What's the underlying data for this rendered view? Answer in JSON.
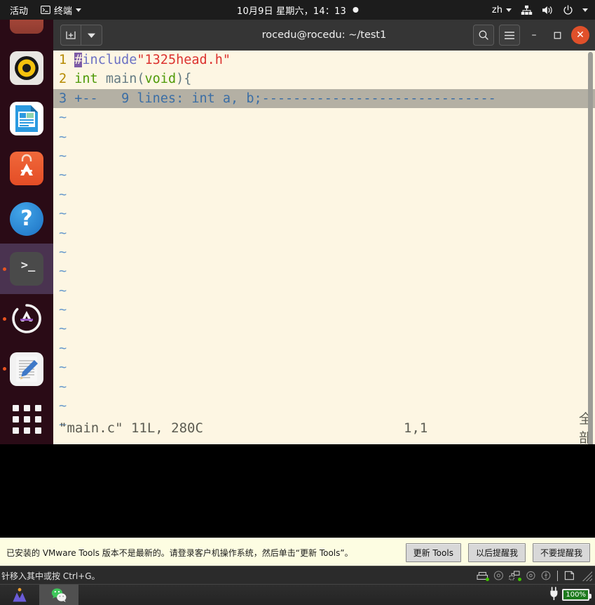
{
  "topbar": {
    "activities": "活动",
    "app_icon": "terminal-appmenu-icon",
    "app_name": "终端",
    "datetime": "10月9日 星期六，14：13",
    "notification_dot": "notification-indicator",
    "keyboard_layout": "zh",
    "system_icons": [
      "network-icon",
      "volume-icon",
      "power-icon",
      "system-menu-caret"
    ]
  },
  "dock": {
    "items": [
      {
        "name": "firefox",
        "label": "Firefox",
        "running": false,
        "active": false
      },
      {
        "name": "rhythmbox",
        "label": "Rhythmbox",
        "running": false,
        "active": false
      },
      {
        "name": "libreoffice-impress",
        "label": "LibreOffice Impress",
        "running": false,
        "active": false
      },
      {
        "name": "ubuntu-software",
        "label": "Ubuntu Software",
        "running": false,
        "active": false
      },
      {
        "name": "help",
        "label": "Help",
        "running": false,
        "active": false
      },
      {
        "name": "terminal",
        "label": "终端",
        "running": true,
        "active": true,
        "glyph": ">_"
      },
      {
        "name": "software-updater",
        "label": "Software Updater",
        "running": true,
        "active": false
      },
      {
        "name": "text-editor",
        "label": "Text Editor",
        "running": true,
        "active": false
      },
      {
        "name": "show-applications",
        "label": "显示应用程序",
        "running": false,
        "active": false
      }
    ]
  },
  "terminal": {
    "title": "rocedu@rocedu: ~/test1",
    "new_tab_label": "+",
    "header_buttons": [
      "new-tab-button",
      "tab-dropdown-button",
      "search-button",
      "hamburger-menu-button",
      "minimize-button",
      "maximize-button",
      "close-button"
    ],
    "minimize_glyph": "–",
    "maximize_glyph": "❐",
    "close_glyph": "✕",
    "editor": {
      "lines": [
        {
          "num": "1",
          "segments": [
            {
              "text": "#",
              "style": "cursor"
            },
            {
              "text": "include",
              "style": "purple"
            },
            {
              "text": "\"1325head.h\"",
              "style": "red"
            }
          ]
        },
        {
          "num": "2",
          "segments": [
            {
              "text": "int",
              "style": "green"
            },
            {
              "text": " main(",
              "style": "dark"
            },
            {
              "text": "void",
              "style": "green"
            },
            {
              "text": "){",
              "style": "dark"
            }
          ]
        },
        {
          "num": "3",
          "fold": true,
          "text": "+--   9 lines: int a, b;------------------------------"
        }
      ],
      "tilde_count": 17,
      "tilde_glyph": "~"
    },
    "status": {
      "file_info": "\"main.c\" 11L, 280C",
      "cursor_position": "1,1",
      "scroll_position": "全 部"
    }
  },
  "vmware_notice": {
    "message": "已安装的 VMware Tools 版本不是最新的。请登录客户机操作系统，然后单击“更新 Tools”。",
    "buttons": [
      {
        "name": "update-tools-button",
        "label": "更新 Tools"
      },
      {
        "name": "remind-later-button",
        "label": "以后提醒我"
      },
      {
        "name": "never-remind-button",
        "label": "不要提醒我"
      }
    ]
  },
  "vmware_status": {
    "hint": "针移入其中或按 Ctrl+G。",
    "devices": [
      "hard-disk-icon",
      "cd-drive-icon",
      "network-adapter-icon",
      "secondary-disc-icon",
      "usb-icon"
    ]
  },
  "taskbar": {
    "items": [
      {
        "name": "vmware-workstation-app",
        "label": "M"
      },
      {
        "name": "wechat-app",
        "label": "WeChat",
        "selected": true
      }
    ],
    "battery": {
      "level": "100%",
      "charging": true
    }
  },
  "colors": {
    "terminal_bg": "#fdf6e3",
    "dock_bg": "#2c0b17",
    "accent": "#e95420",
    "fold_bg": "#b4b0a4",
    "fold_fg": "#3b6ea5",
    "vm_bar_bg": "#fdfde2",
    "battery_green": "#1d7a1d"
  }
}
